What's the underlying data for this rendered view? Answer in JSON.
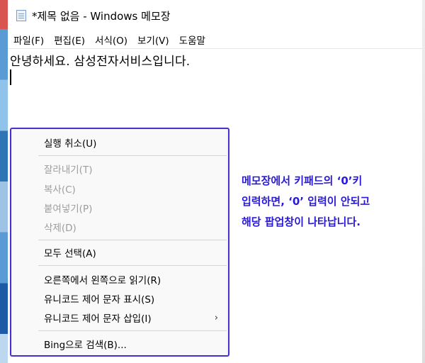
{
  "window": {
    "title": "*제목 없음 - Windows 메모장",
    "icon": "notepad-icon"
  },
  "menubar": {
    "items": [
      "파일(F)",
      "편집(E)",
      "서식(O)",
      "보기(V)",
      "도움말"
    ]
  },
  "editor": {
    "text": "안녕하세요. 삼성전자서비스입니다."
  },
  "context_menu": {
    "items": [
      {
        "label": "실행 취소(U)",
        "enabled": true
      },
      {
        "label": "잘라내기(T)",
        "enabled": false
      },
      {
        "label": "복사(C)",
        "enabled": false
      },
      {
        "label": "붙여넣기(P)",
        "enabled": false
      },
      {
        "label": "삭제(D)",
        "enabled": false
      },
      {
        "label": "모두 선택(A)",
        "enabled": true
      },
      {
        "label": "오른쪽에서 왼쪽으로 읽기(R)",
        "enabled": true
      },
      {
        "label": "유니코드 제어 문자 표시(S)",
        "enabled": true
      },
      {
        "label": "유니코드 제어 문자 삽입(I)",
        "enabled": true,
        "submenu_arrow": "›"
      },
      {
        "label": "Bing으로 검색(B)...",
        "enabled": true
      }
    ]
  },
  "annotation": {
    "lines": [
      "메모장에서 키패드의 ‘0’키",
      "입력하면, ‘0’ 입력이 안되고",
      "해당 팝업창이 나타납니다."
    ],
    "color": "#2a1ad8"
  }
}
